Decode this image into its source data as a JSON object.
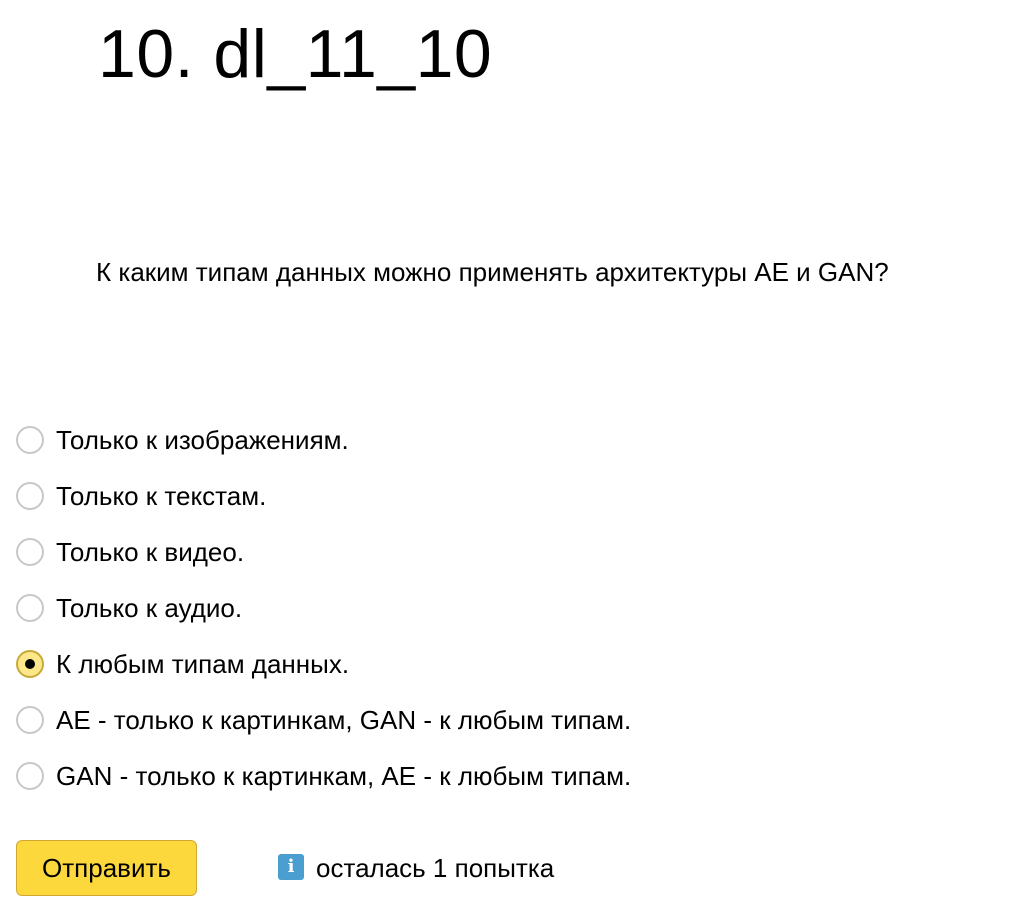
{
  "quiz": {
    "title": "10. dl_11_10",
    "question": "К каким типам данных можно применять архитектуры AE и GAN?",
    "options": [
      {
        "label": "Только к изображениям.",
        "selected": false
      },
      {
        "label": "Только к текстам.",
        "selected": false
      },
      {
        "label": "Только к видео.",
        "selected": false
      },
      {
        "label": "Только к аудио.",
        "selected": false
      },
      {
        "label": "К любым типам данных.",
        "selected": true
      },
      {
        "label": "AE - только к картинкам, GAN - к любым типам.",
        "selected": false
      },
      {
        "label": "GAN - только к картинкам, AE - к любым типам.",
        "selected": false
      }
    ],
    "submit_label": "Отправить",
    "attempts_text": "осталась 1 попытка",
    "info_icon": "info-icon",
    "info_glyph": "i"
  },
  "colors": {
    "button_background": "#fcd83c",
    "button_border": "#cfa934",
    "selected_radio_background": "#fce88a",
    "info_icon_background": "#4b9fd0"
  }
}
